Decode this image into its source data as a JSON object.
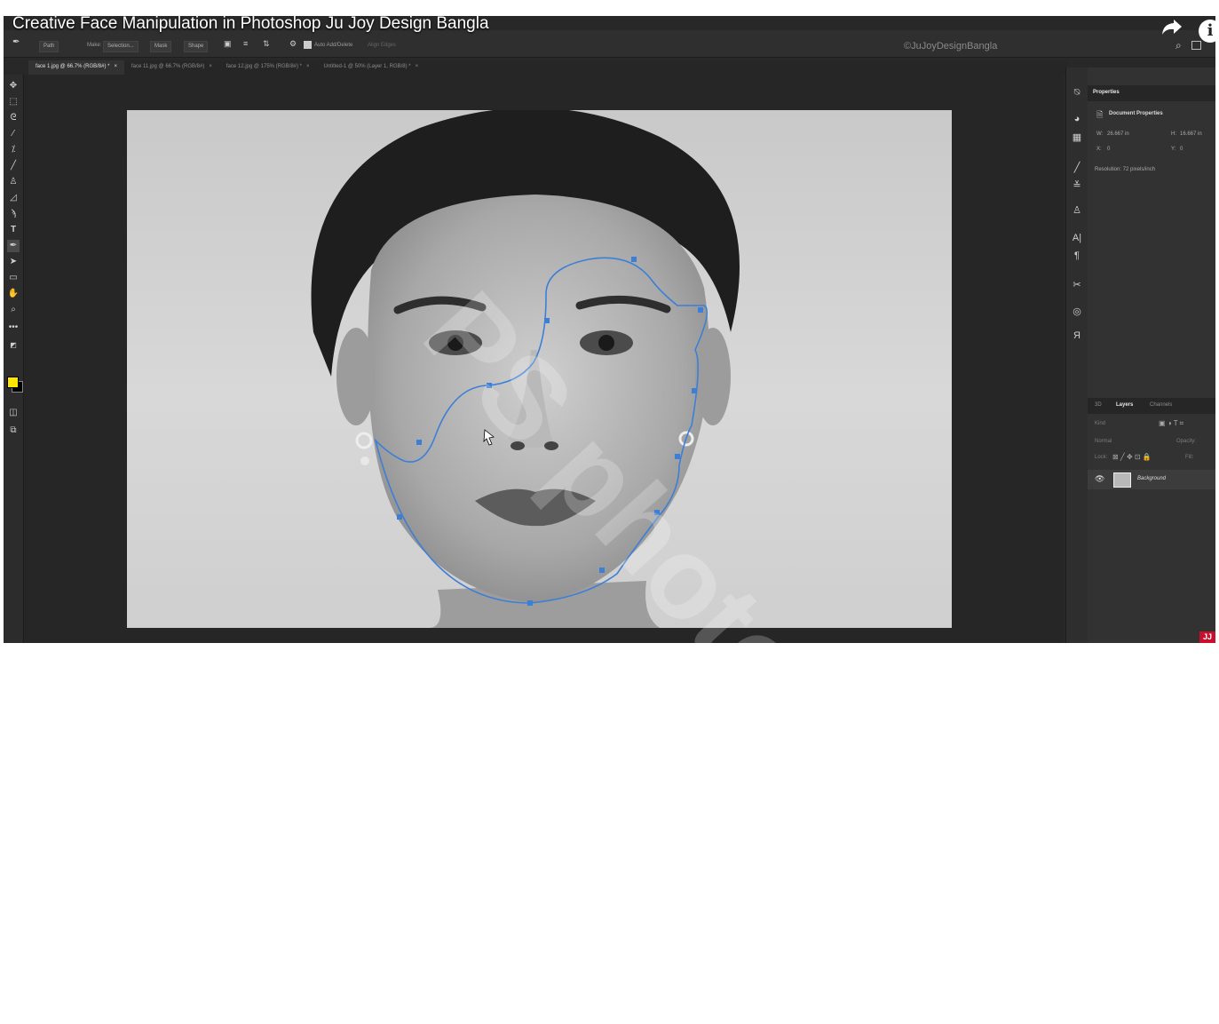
{
  "video": {
    "title": "Creative Face Manipulation in Photoshop Ju Joy Design Bangla",
    "watermark": "©JuJoyDesignBangla",
    "overlay_mark": "PS photoshop ©"
  },
  "options_bar": {
    "mode": "Path",
    "make_label": "Make:",
    "selection_button": "Selection...",
    "mask_button": "Mask",
    "shape_button": "Shape",
    "auto_add_delete": "Auto Add/Delete",
    "align_edges": "Align Edges"
  },
  "doc_tabs": [
    {
      "label": "face 1.jpg @ 66.7% (RGB/8#) *",
      "close": "×"
    },
    {
      "label": "face 11.jpg @ 66.7% (RGB/8#)",
      "close": "×"
    },
    {
      "label": "face 12.jpg @ 175% (RGB/8#) *",
      "close": "×"
    },
    {
      "label": "Untitled-1 @ 50% (Layer 1, RGB/8) *",
      "close": "×"
    }
  ],
  "properties": {
    "tab": "Properties",
    "section": "Document Properties",
    "w_label": "W:",
    "w_value": "26.667 in",
    "h_label": "H:",
    "h_value": "16.667 in",
    "x_label": "X:",
    "x_value": "0",
    "y_label": "Y:",
    "y_value": "0",
    "resolution": "Resolution: 72 pixels/inch"
  },
  "layers_panel": {
    "tabs": [
      "3D",
      "Layers",
      "Channels"
    ],
    "kind_placeholder": "Kind",
    "blend_mode": "Normal",
    "opacity_label": "Opacity:",
    "lock_label": "Lock:",
    "fill_label": "Fill:",
    "layer_name": "Background"
  },
  "brand_badge": "JJ",
  "colors": {
    "foreground": "#ffe600",
    "background": "#000000",
    "path": "#3d7fd6"
  }
}
